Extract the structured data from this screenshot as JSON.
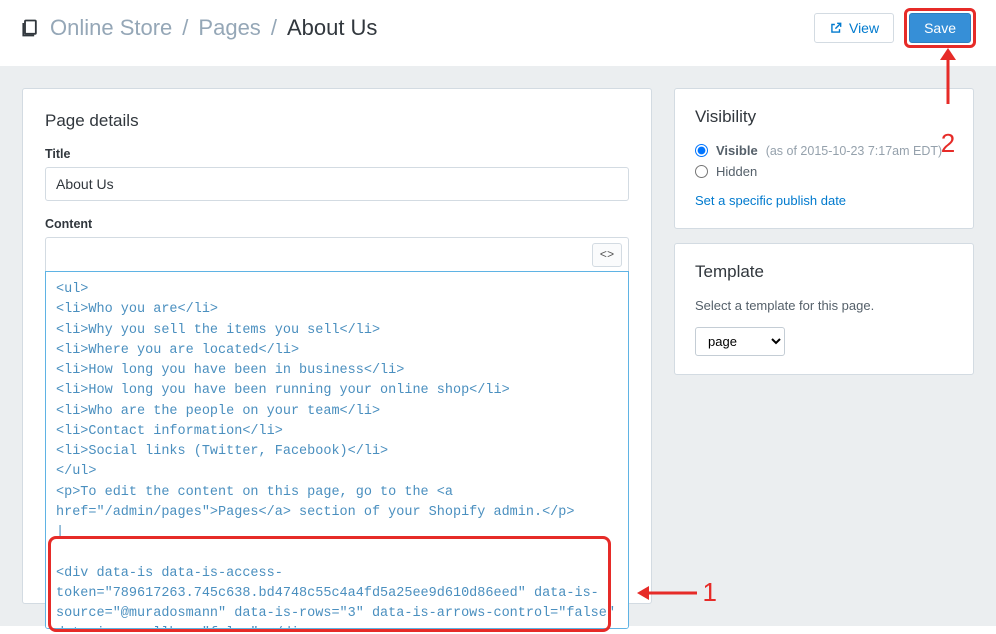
{
  "breadcrumb": {
    "section": "Online Store",
    "subsection": "Pages",
    "current": "About Us"
  },
  "actions": {
    "view_label": "View",
    "save_label": "Save"
  },
  "page_details": {
    "heading": "Page details",
    "title_label": "Title",
    "title_value": "About Us",
    "content_label": "Content",
    "code_toggle_label": "<>",
    "content_value": "<ul>\n<li>Who you are</li>\n<li>Why you sell the items you sell</li>\n<li>Where you are located</li>\n<li>How long you have been in business</li>\n<li>How long you have been running your online shop</li>\n<li>Who are the people on your team</li>\n<li>Contact information</li>\n<li>Social links (Twitter, Facebook)</li>\n</ul>\n<p>To edit the content on this page, go to the <a href=\"/admin/pages\">Pages</a> section of your Shopify admin.</p>\n|\n\n<div data-is data-is-access-token=\"789617263.745c638.bd4748c55c4a4fd5a25ee9d610d86eed\" data-is-source=\"@muradosmann\" data-is-rows=\"3\" data-is-arrows-control=\"false\" data-is-scrollbar=\"false\"></div>"
  },
  "visibility": {
    "heading": "Visibility",
    "visible_label": "Visible",
    "visible_meta": "(as of 2015-10-23 7:17am EDT)",
    "hidden_label": "Hidden",
    "selected": "visible",
    "publish_link": "Set a specific publish date"
  },
  "template": {
    "heading": "Template",
    "description": "Select a template for this page.",
    "selected": "page"
  },
  "annotations": {
    "one": "1",
    "two": "2"
  }
}
